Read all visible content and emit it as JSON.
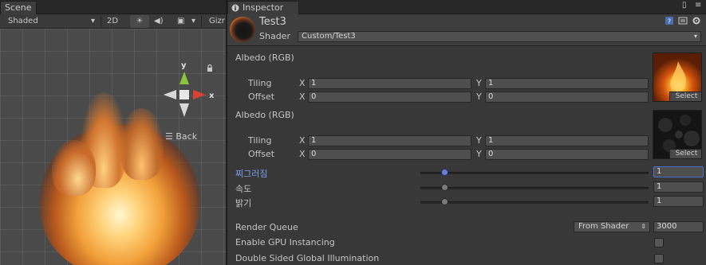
{
  "scene": {
    "tab_label": "Scene",
    "toolbar": {
      "draw_mode": "Shaded",
      "mode_2d": "2D",
      "gizmos_label": "Gizr"
    },
    "gizmo": {
      "y_label": "y",
      "x_label": "x"
    },
    "back_label": "Back"
  },
  "inspector": {
    "tab_label": "Inspector",
    "material_name": "Test3",
    "shader_label": "Shader",
    "shader_value": "Custom/Test3",
    "textures": [
      {
        "label": "Albedo (RGB)",
        "tiling_label": "Tiling",
        "offset_label": "Offset",
        "tiling_x": "1",
        "tiling_y": "1",
        "offset_x": "0",
        "offset_y": "0",
        "select_label": "Select"
      },
      {
        "label": "Albedo (RGB)",
        "tiling_label": "Tiling",
        "offset_label": "Offset",
        "tiling_x": "1",
        "tiling_y": "1",
        "offset_x": "0",
        "offset_y": "0",
        "select_label": "Select"
      }
    ],
    "axis": {
      "x": "X",
      "y": "Y"
    },
    "sliders": [
      {
        "label": "찌그러짐",
        "value": "1",
        "level": 0.11,
        "active": true
      },
      {
        "label": "속도",
        "value": "1",
        "level": 0.11,
        "active": false
      },
      {
        "label": "밝기",
        "value": "1",
        "level": 0.11,
        "active": false
      }
    ],
    "render_queue": {
      "label": "Render Queue",
      "mode": "From Shader",
      "value": "3000"
    },
    "gpu_instancing": {
      "label": "Enable GPU Instancing",
      "checked": false
    },
    "double_sided_gi": {
      "label": "Double Sided Global Illumination",
      "checked": false
    }
  },
  "colors": {
    "accent_active": "#7e9ff0",
    "gizmo_y": "#8cc43a",
    "gizmo_x": "#d8412f"
  }
}
